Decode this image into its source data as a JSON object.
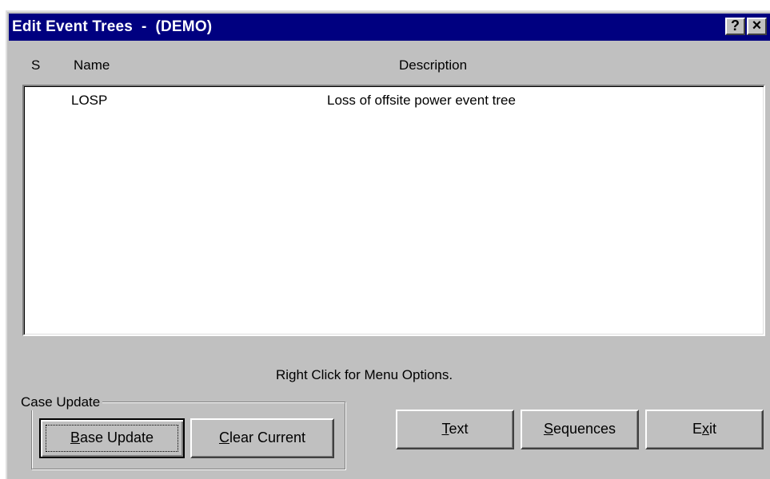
{
  "window": {
    "title": "Edit Event Trees  -  (DEMO)",
    "help_label": "?",
    "close_label": "×"
  },
  "list": {
    "columns": {
      "status": "S",
      "name": "Name",
      "description": "Description"
    },
    "rows": [
      {
        "status": "",
        "name": "LOSP",
        "description": "Loss of offsite power event tree"
      }
    ]
  },
  "hint": "Right Click for Menu Options.",
  "case_update": {
    "legend": "Case Update",
    "base_update": {
      "mnemonic": "B",
      "rest": "ase Update"
    },
    "clear_current": {
      "mnemonic": "C",
      "rest": "lear Current"
    }
  },
  "buttons": {
    "text": {
      "mnemonic": "T",
      "rest": "ext"
    },
    "sequences": {
      "mnemonic": "S",
      "rest": "equences"
    },
    "exit": {
      "pre": "E",
      "mnemonic": "x",
      "rest": "it"
    }
  },
  "colors": {
    "titlebar": "#000080",
    "face": "#c0c0c0",
    "list_bg": "#ffffff"
  }
}
